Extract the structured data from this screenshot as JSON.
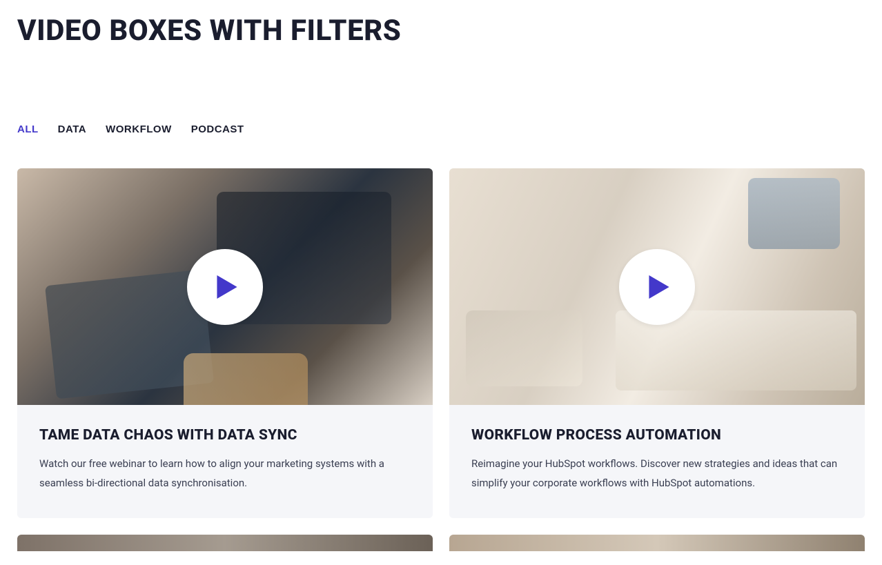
{
  "page": {
    "title": "VIDEO BOXES WITH FILTERS"
  },
  "filters": {
    "active_index": 0,
    "items": [
      {
        "label": "ALL"
      },
      {
        "label": "DATA"
      },
      {
        "label": "WORKFLOW"
      },
      {
        "label": "PODCAST"
      }
    ]
  },
  "colors": {
    "accent": "#4338ca",
    "text": "#1a1d2e",
    "card_bg": "#f5f6f9"
  },
  "cards": [
    {
      "title": "TAME DATA CHAOS WITH DATA SYNC",
      "description": "Watch our free webinar to learn how to align your marketing systems with a seamless bi-directional data synchronisation.",
      "play_icon": "play-icon"
    },
    {
      "title": "WORKFLOW PROCESS AUTOMATION",
      "description": "Reimagine your HubSpot workflows. Discover new strategies and ideas that can simplify your corporate workflows with HubSpot automations.",
      "play_icon": "play-icon"
    }
  ]
}
